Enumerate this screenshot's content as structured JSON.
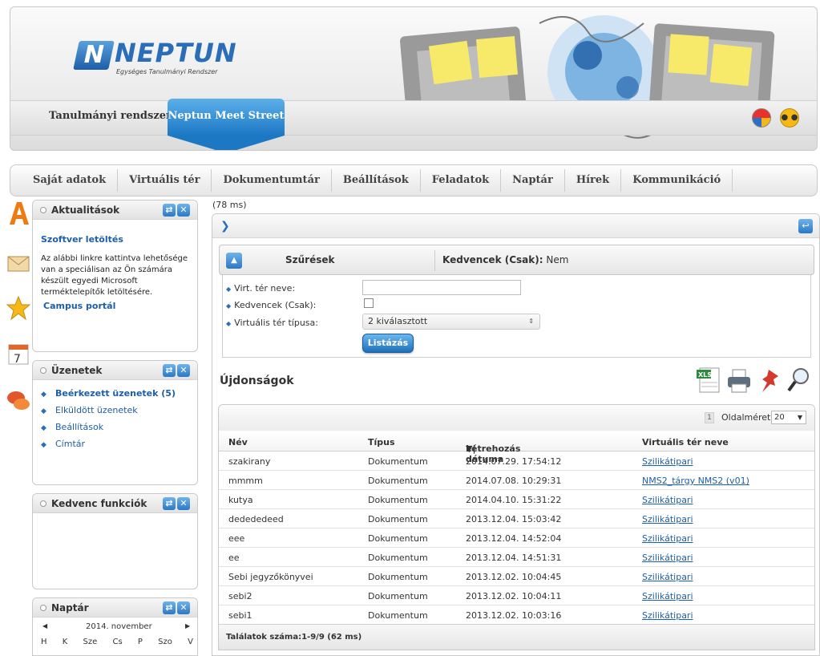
{
  "header": {
    "logo_name": "NEPTUN",
    "logo_subtitle": "Egységes Tanulmányi Rendszer",
    "tab_study": "Tanulmányi rendszer",
    "tab_meetstreet": "Neptun Meet Street"
  },
  "menu": {
    "items": [
      "Saját adatok",
      "Virtuális tér",
      "Dokumentumtár",
      "Beállítások",
      "Feladatok",
      "Naptár",
      "Hírek",
      "Kommunikáció"
    ]
  },
  "sidebar": {
    "news": {
      "title": "Aktualitások",
      "headline": "Szoftver letöltés",
      "text": "Az alábbi linkre kattintva lehetősége van a speciálisan az Ön számára készült egyedi Microsoft terméktelepítők letöltésére.",
      "link": "Campus portál"
    },
    "messages": {
      "title": "Üzenetek",
      "items": [
        "Beérkezett üzenetek (5)",
        "Elküldött üzenetek",
        "Beállítások",
        "Címtár"
      ]
    },
    "favorites": {
      "title": "Kedvenc funkciók"
    },
    "calendar": {
      "title": "Naptár",
      "month": "2014. november",
      "days": [
        "H",
        "K",
        "Sze",
        "Cs",
        "P",
        "Szo",
        "V"
      ]
    }
  },
  "main": {
    "timing": "(78 ms)",
    "filter": {
      "title": "Szűrések",
      "favorites_label": "Kedvencek (Csak):",
      "favorites_value": "Nem"
    },
    "form": {
      "name_label": "Virt. tér neve:",
      "name_value": "",
      "fav_label": "Kedvencek (Csak):",
      "type_label": "Virtuális tér típusa:",
      "type_value": "2 kiválasztott",
      "list_button": "Listázás"
    },
    "section_title": "Újdonságok",
    "grid": {
      "page_number": "1",
      "page_size_label": "Oldalméret",
      "page_size": "20",
      "columns": [
        "Név",
        "Típus",
        "Létrehozás dátuma",
        "Virtuális tér neve"
      ],
      "rows": [
        [
          "szakirany",
          "Dokumentum",
          "2014.07.29. 17:54:12",
          "Szilikátipari"
        ],
        [
          "mmmm",
          "Dokumentum",
          "2014.07.08. 10:29:31",
          "NMS2_tárgy NMS2 (v01)"
        ],
        [
          "kutya",
          "Dokumentum",
          "2014.04.10. 15:31:22",
          "Szilikátipari"
        ],
        [
          "dedededeed",
          "Dokumentum",
          "2013.12.04. 15:03:42",
          "Szilikátipari"
        ],
        [
          "eee",
          "Dokumentum",
          "2013.12.04. 14:52:04",
          "Szilikátipari"
        ],
        [
          "ee",
          "Dokumentum",
          "2013.12.04. 14:51:31",
          "Szilikátipari"
        ],
        [
          "Sebi jegyzőkönyvei",
          "Dokumentum",
          "2013.12.02. 10:04:45",
          "Szilikátipari"
        ],
        [
          "sebi2",
          "Dokumentum",
          "2013.12.02. 10:04:11",
          "Szilikátipari"
        ],
        [
          "sebi1",
          "Dokumentum",
          "2013.12.02. 10:03:16",
          "Szilikátipari"
        ]
      ],
      "footer": "Találatok száma:1-9/9 (62 ms)"
    }
  },
  "colors": {
    "accent": "#2a6db8",
    "tab_active": "#1d78c4"
  }
}
